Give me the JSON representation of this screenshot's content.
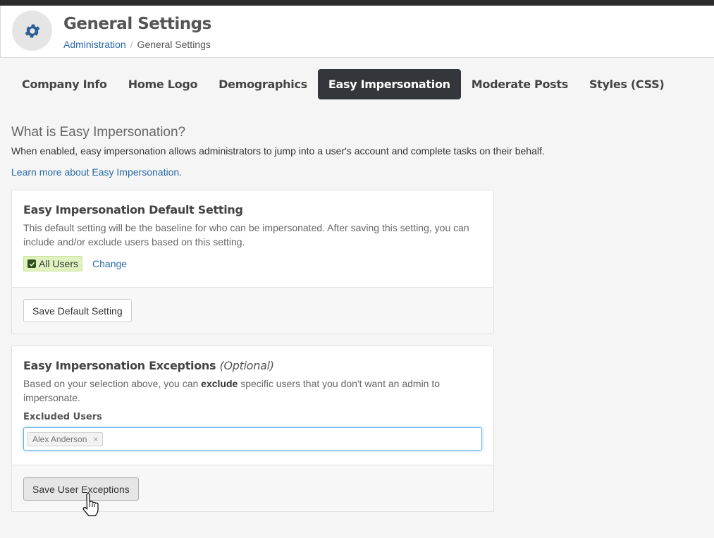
{
  "header": {
    "title": "General Settings",
    "icon": "gear-icon",
    "breadcrumb": {
      "root": "Administration",
      "separator": "/",
      "current": "General Settings"
    }
  },
  "tabs": [
    {
      "label": "Company Info",
      "active": false
    },
    {
      "label": "Home Logo",
      "active": false
    },
    {
      "label": "Demographics",
      "active": false
    },
    {
      "label": "Easy Impersonation",
      "active": true
    },
    {
      "label": "Moderate Posts",
      "active": false
    },
    {
      "label": "Styles (CSS)",
      "active": false
    }
  ],
  "intro": {
    "title": "What is Easy Impersonation?",
    "description": "When enabled, easy impersonation allows administrators to jump into a user's account and complete tasks on their behalf.",
    "learn_more": "Learn more about Easy Impersonation."
  },
  "default_panel": {
    "title": "Easy Impersonation Default Setting",
    "description": "This default setting will be the baseline for who can be impersonated. After saving this setting, you can include and/or exclude users based on this setting.",
    "selected_value": "All Users",
    "change_label": "Change",
    "save_label": "Save Default Setting"
  },
  "exceptions_panel": {
    "title": "Easy Impersonation Exceptions",
    "title_optional": "(Optional)",
    "description_pre": "Based on your selection above, you can",
    "description_bold": "exclude",
    "description_post": "specific users that you don't want an admin to impersonate.",
    "field_label": "Excluded Users",
    "excluded_users": [
      "Alex Anderson"
    ],
    "tag_remove": "×",
    "save_label": "Save User Exceptions"
  },
  "colors": {
    "accent_link": "#2a6aa8",
    "active_tab": "#33373c",
    "badge_bg": "#dff2bf",
    "focus_border": "#66afe9"
  }
}
